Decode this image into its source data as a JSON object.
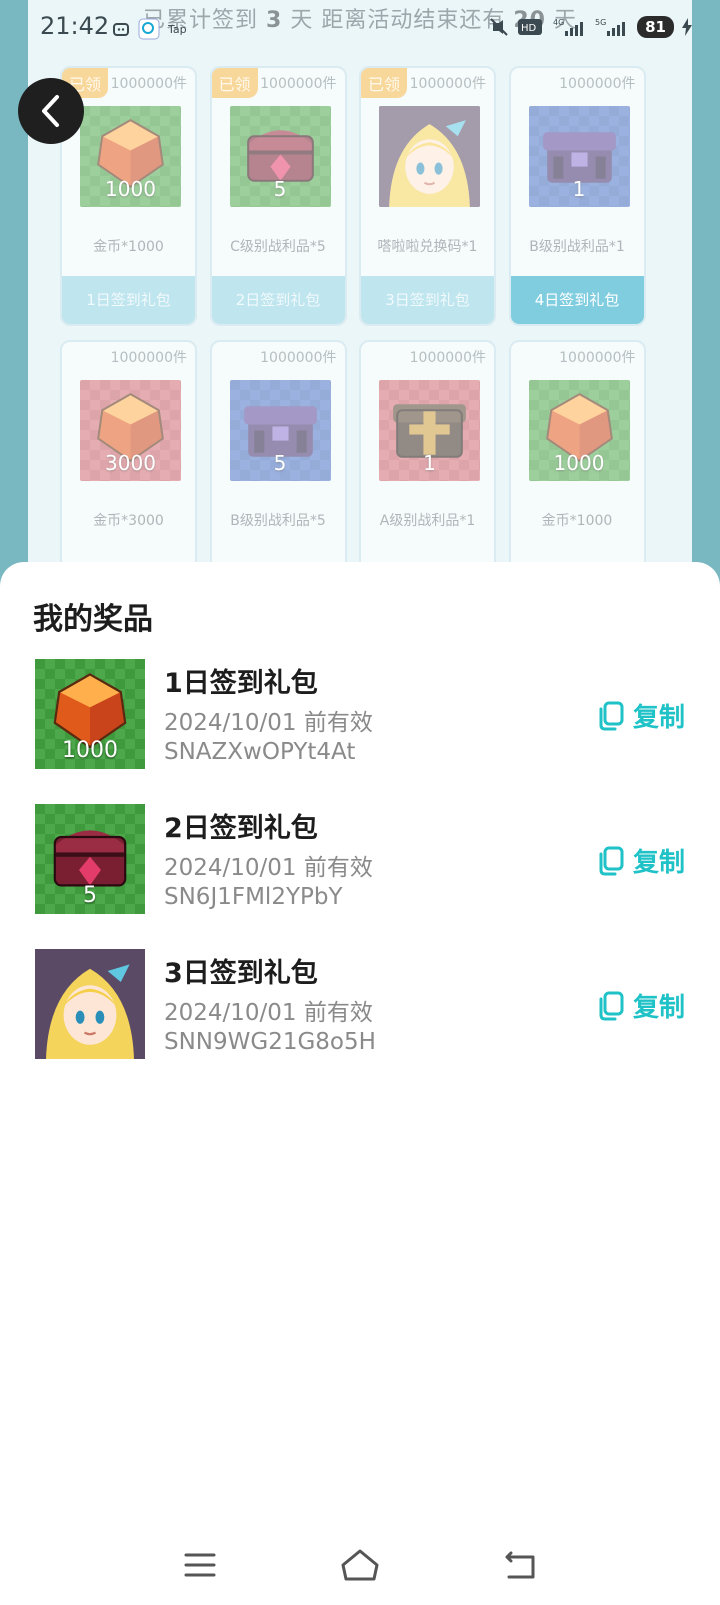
{
  "status_bar": {
    "time": "21:42",
    "battery": "81",
    "network_labels": [
      "HD",
      "4G",
      "5G"
    ]
  },
  "background": {
    "banner_prefix": "已累计签到",
    "banner_days": "3",
    "banner_mid": "天   距离活动结束还有",
    "banner_remaining": "20",
    "banner_suffix": "天",
    "claimed_label": "已领",
    "cards": [
      {
        "stock": "1000000件",
        "name": "金币*1000",
        "button": "1日签到礼包",
        "qty": "1000",
        "claimed": true,
        "theme": "green",
        "item": "gem"
      },
      {
        "stock": "1000000件",
        "name": "C级别战利品*5",
        "button": "2日签到礼包",
        "qty": "5",
        "claimed": true,
        "theme": "green",
        "item": "chest-red"
      },
      {
        "stock": "1000000件",
        "name": "嗒啦啦兑换码*1",
        "button": "3日签到礼包",
        "qty": "",
        "claimed": true,
        "theme": "purple",
        "item": "avatar"
      },
      {
        "stock": "1000000件",
        "name": "B级别战利品*1",
        "button": "4日签到礼包",
        "qty": "1",
        "claimed": false,
        "theme": "blue",
        "item": "chest-purple"
      },
      {
        "stock": "1000000件",
        "name": "金币*3000",
        "button": "",
        "qty": "3000",
        "claimed": false,
        "theme": "red",
        "item": "gem"
      },
      {
        "stock": "1000000件",
        "name": "B级别战利品*5",
        "button": "",
        "qty": "5",
        "claimed": false,
        "theme": "blue",
        "item": "chest-purple"
      },
      {
        "stock": "1000000件",
        "name": "A级别战利品*1",
        "button": "",
        "qty": "1",
        "claimed": false,
        "theme": "red",
        "item": "chest-gold"
      },
      {
        "stock": "1000000件",
        "name": "金币*1000",
        "button": "",
        "qty": "1000",
        "claimed": false,
        "theme": "green",
        "item": "gem"
      }
    ]
  },
  "sheet": {
    "title": "我的奖品",
    "copy_label": "复制",
    "prizes": [
      {
        "name": "1日签到礼包",
        "expiry": "2024/10/01 前有效",
        "code": "SNAZXwOPYt4At",
        "qty": "1000",
        "item": "gem"
      },
      {
        "name": "2日签到礼包",
        "expiry": "2024/10/01 前有效",
        "code": "SN6J1FMl2YPbY",
        "qty": "5",
        "item": "chest-red"
      },
      {
        "name": "3日签到礼包",
        "expiry": "2024/10/01 前有效",
        "code": "SNN9WG21G8o5H",
        "qty": "",
        "item": "avatar"
      }
    ]
  },
  "colors": {
    "accent": "#1fc2c7",
    "claimed_badge": "#f2b64a",
    "active_button": "#1aa5c6"
  }
}
